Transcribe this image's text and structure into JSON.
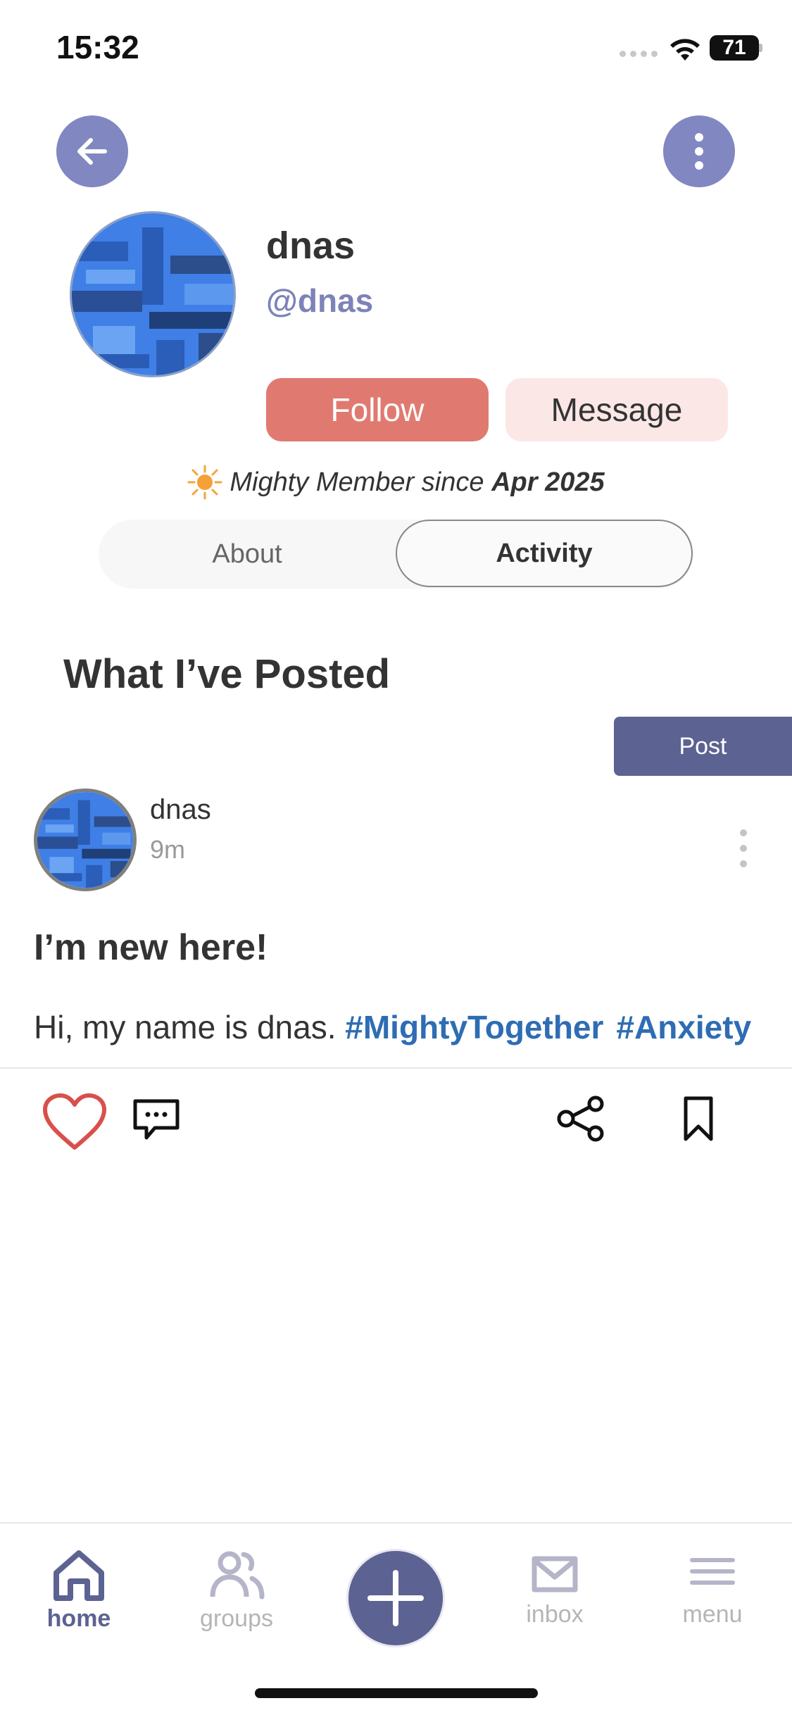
{
  "status_bar": {
    "time": "15:32",
    "battery": "71"
  },
  "header": {
    "back_icon": "arrow-left-icon",
    "more_icon": "vertical-dots-icon"
  },
  "profile": {
    "name": "dnas",
    "handle": "@dnas",
    "follow_label": "Follow",
    "message_label": "Message",
    "member_prefix": "Mighty Member since",
    "member_date": "Apr 2025"
  },
  "tabs": [
    {
      "label": "About",
      "active": false
    },
    {
      "label": "Activity",
      "active": true
    }
  ],
  "section": {
    "title": "What I’ve Posted",
    "post_button": "Post"
  },
  "post": {
    "author": "dnas",
    "time": "9m",
    "title": "I’m new here!",
    "body_text": "Hi, my name is dnas.",
    "hashtags": [
      "#MightyTogether",
      "#Anxiety"
    ]
  },
  "bottom_nav": {
    "home": "home",
    "groups": "groups",
    "inbox": "inbox",
    "menu": "menu"
  },
  "colors": {
    "accent": "#8187c1",
    "nav_active": "#5c6291",
    "follow": "#e07a70",
    "message_bg": "#fbe8e6",
    "hashtag": "#2e6db3",
    "like_heart": "#d9504b"
  }
}
